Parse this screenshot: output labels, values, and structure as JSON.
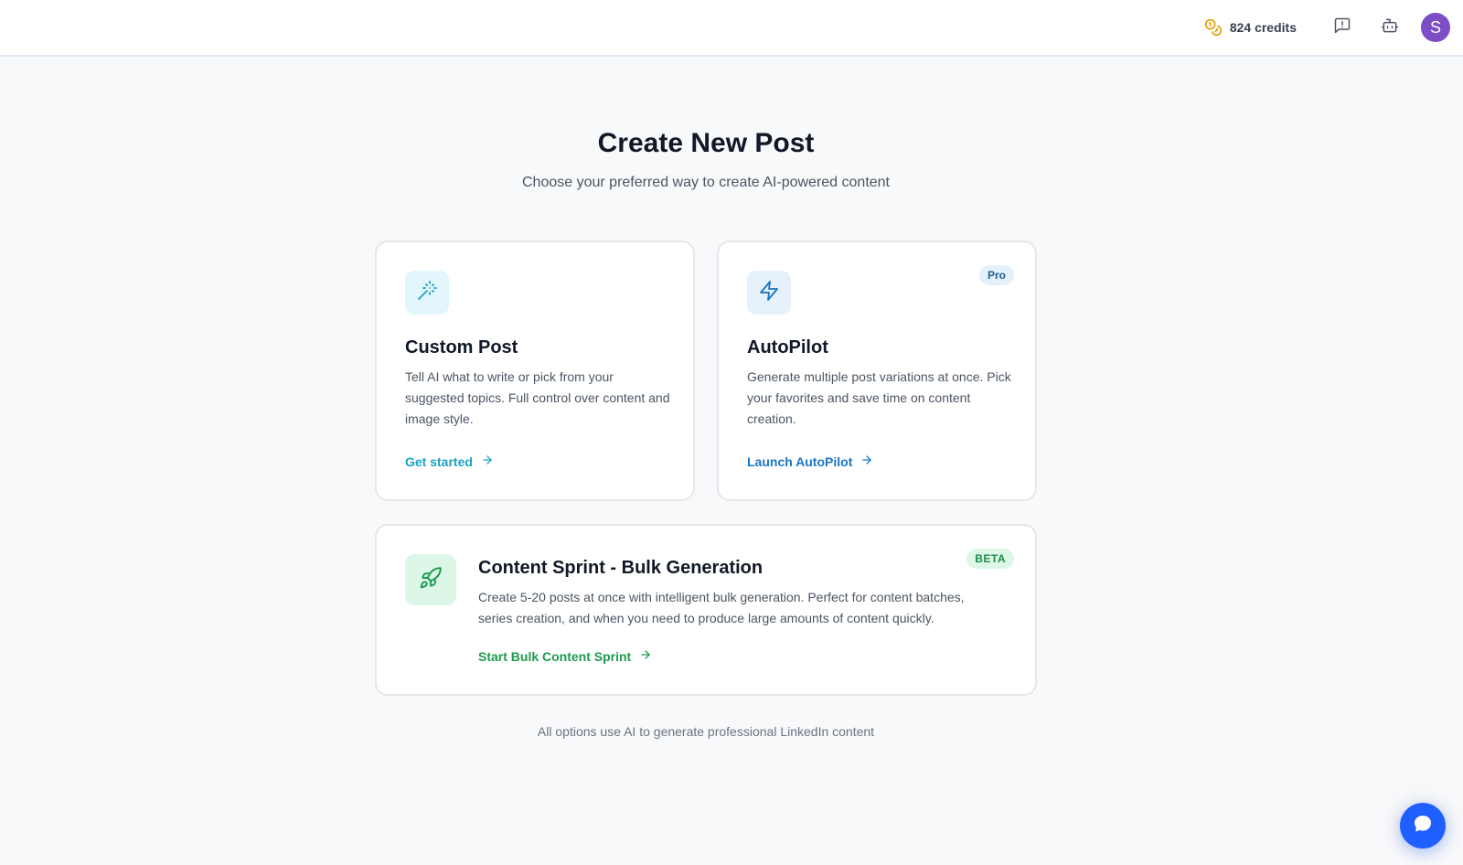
{
  "header": {
    "credits_label": "824 credits",
    "credits_icon": "coins-icon",
    "feedback_icon": "message-alert-icon",
    "bot_icon": "bot-icon",
    "avatar_initial": "S",
    "avatar_color": "#7c4dc4"
  },
  "main": {
    "title": "Create New Post",
    "subtitle": "Choose your preferred way to create AI-powered content",
    "footer_note": "All options use AI to generate professional LinkedIn content"
  },
  "cards": {
    "custom": {
      "icon": "magic-wand-icon",
      "title": "Custom Post",
      "description": "Tell AI what to write or pick from your suggested topics. Full control over content and image style.",
      "link_label": "Get started",
      "accent": "#1aa3c3"
    },
    "autopilot": {
      "icon": "lightning-icon",
      "badge": "Pro",
      "title": "AutoPilot",
      "description": "Generate multiple post variations at once. Pick your favorites and save time on content creation.",
      "link_label": "Launch AutoPilot",
      "accent": "#1976c2"
    },
    "sprint": {
      "icon": "rocket-icon",
      "badge": "BETA",
      "title": "Content Sprint - Bulk Generation",
      "description": "Create 5-20 posts at once with intelligent bulk generation. Perfect for content batches, series creation, and when you need to produce large amounts of content quickly.",
      "link_label": "Start Bulk Content Sprint",
      "accent": "#1f9a4f"
    }
  },
  "chat_widget": {
    "icon": "chat-bubble-icon",
    "color": "#1f5eff"
  }
}
